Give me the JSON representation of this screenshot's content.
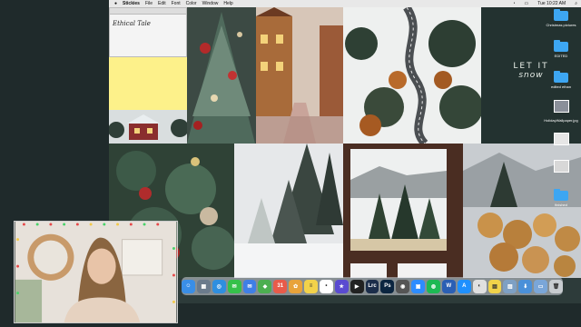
{
  "menubar": {
    "app_name": "Stickies",
    "menus": [
      "File",
      "Edit",
      "Font",
      "Color",
      "Window",
      "Help"
    ],
    "clock": "Tue 10:22 AM"
  },
  "stickies": {
    "note_text": "Ethical Tale"
  },
  "desktop": {
    "headline": "LET IT",
    "subline": "snow",
    "icons": [
      {
        "label": "Christmas pictures",
        "kind": "folder"
      },
      {
        "label": "EDITED",
        "kind": "folder"
      },
      {
        "label": "edited ethan",
        "kind": "folder"
      },
      {
        "label": "",
        "kind": "image"
      },
      {
        "label": "HolidayWallpaper.jpg",
        "kind": "image"
      },
      {
        "label": "",
        "kind": "image"
      },
      {
        "label": "",
        "kind": "image"
      },
      {
        "label": "finished",
        "kind": "folder"
      }
    ]
  },
  "dock": {
    "apps": [
      {
        "name": "finder-icon",
        "glyph": "☺",
        "color": "#3a8ee6"
      },
      {
        "name": "launchpad-icon",
        "glyph": "▦",
        "color": "#6b7b8c"
      },
      {
        "name": "safari-icon",
        "glyph": "◎",
        "color": "#2f8fe0"
      },
      {
        "name": "messages-icon",
        "glyph": "✉",
        "color": "#35c14a"
      },
      {
        "name": "mail-icon",
        "glyph": "✉",
        "color": "#3f7fe6"
      },
      {
        "name": "maps-icon",
        "glyph": "◆",
        "color": "#4caf50"
      },
      {
        "name": "calendar-icon",
        "glyph": "31",
        "color": "#e85b4a"
      },
      {
        "name": "photos-icon",
        "glyph": "✿",
        "color": "#e8a33a"
      },
      {
        "name": "notes-icon",
        "glyph": "≡",
        "color": "#f2d24a"
      },
      {
        "name": "reminders-icon",
        "glyph": "•",
        "color": "#ffffff"
      },
      {
        "name": "imovie-icon",
        "glyph": "★",
        "color": "#5a4bd1"
      },
      {
        "name": "final-cut-icon",
        "glyph": "▶",
        "color": "#222222"
      },
      {
        "name": "lightroom-icon",
        "glyph": "Lrc",
        "color": "#1b2d4a"
      },
      {
        "name": "photoshop-icon",
        "glyph": "Ps",
        "color": "#0b2540"
      },
      {
        "name": "compressor-icon",
        "glyph": "◉",
        "color": "#555555"
      },
      {
        "name": "zoom-icon",
        "glyph": "▣",
        "color": "#2d8cff"
      },
      {
        "name": "spotify-icon",
        "glyph": "◍",
        "color": "#1db954"
      },
      {
        "name": "word-icon",
        "glyph": "W",
        "color": "#2b5fb4"
      },
      {
        "name": "app-store-icon",
        "glyph": "A",
        "color": "#1e90ff"
      },
      {
        "name": "chrome-icon",
        "glyph": "◐",
        "color": "#e0e0e0"
      },
      {
        "name": "stickies-icon",
        "glyph": "▤",
        "color": "#f0d34a"
      },
      {
        "name": "preview-icon",
        "glyph": "▨",
        "color": "#7ea0c4"
      },
      {
        "name": "downloads-icon",
        "glyph": "⬇",
        "color": "#4a90d9"
      },
      {
        "name": "folder-dock-icon",
        "glyph": "▭",
        "color": "#7aa6d8"
      },
      {
        "name": "trash-icon",
        "glyph": "🗑",
        "color": "#c8ccd0"
      }
    ]
  }
}
